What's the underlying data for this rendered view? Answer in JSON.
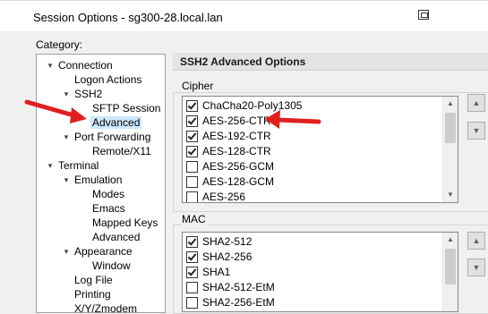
{
  "window": {
    "title": "Session Options - sg300-28.local.lan"
  },
  "category_label": "Category:",
  "tree": [
    {
      "label": "Connection",
      "expander": "▾",
      "name": "tree-item-connection"
    },
    {
      "label": "Logon Actions",
      "expander": "",
      "name": "tree-item-logon-actions"
    },
    {
      "label": "SSH2",
      "expander": "▾",
      "name": "tree-item-ssh2"
    },
    {
      "label": "SFTP Session",
      "expander": "",
      "name": "tree-item-sftp-session"
    },
    {
      "label": "Advanced",
      "expander": "",
      "name": "tree-item-advanced",
      "selected": true
    },
    {
      "label": "Port Forwarding",
      "expander": "▾",
      "name": "tree-item-port-forwarding"
    },
    {
      "label": "Remote/X11",
      "expander": "",
      "name": "tree-item-remote-x11"
    },
    {
      "label": "Terminal",
      "expander": "▾",
      "name": "tree-item-terminal"
    },
    {
      "label": "Emulation",
      "expander": "▾",
      "name": "tree-item-emulation"
    },
    {
      "label": "Modes",
      "expander": "",
      "name": "tree-item-modes"
    },
    {
      "label": "Emacs",
      "expander": "",
      "name": "tree-item-emacs"
    },
    {
      "label": "Mapped Keys",
      "expander": "",
      "name": "tree-item-mapped-keys"
    },
    {
      "label": "Advanced",
      "expander": "",
      "name": "tree-item-emulation-advanced"
    },
    {
      "label": "Appearance",
      "expander": "▾",
      "name": "tree-item-appearance"
    },
    {
      "label": "Window",
      "expander": "",
      "name": "tree-item-window"
    },
    {
      "label": "Log File",
      "expander": "",
      "name": "tree-item-log-file"
    },
    {
      "label": "Printing",
      "expander": "",
      "name": "tree-item-printing"
    },
    {
      "label": "X/Y/Zmodem",
      "expander": "",
      "name": "tree-item-xyzmodem"
    }
  ],
  "panel": {
    "title": "SSH2 Advanced Options"
  },
  "cipher": {
    "label": "Cipher",
    "items": [
      {
        "label": "ChaCha20-Poly1305",
        "checked": true
      },
      {
        "label": "AES-256-CTR",
        "checked": true
      },
      {
        "label": "AES-192-CTR",
        "checked": true
      },
      {
        "label": "AES-128-CTR",
        "checked": true
      },
      {
        "label": "AES-256-GCM",
        "checked": false
      },
      {
        "label": "AES-128-GCM",
        "checked": false
      },
      {
        "label": "AES-256",
        "checked": false
      }
    ]
  },
  "mac": {
    "label": "MAC",
    "items": [
      {
        "label": "SHA2-512",
        "checked": true
      },
      {
        "label": "SHA2-256",
        "checked": true
      },
      {
        "label": "SHA1",
        "checked": true
      },
      {
        "label": "SHA2-512-EtM",
        "checked": false
      },
      {
        "label": "SHA2-256-EtM",
        "checked": false
      }
    ]
  },
  "icons": {
    "up": "up-arrow-icon",
    "down": "down-arrow-icon",
    "annotation": "red-arrow-icon"
  },
  "colors": {
    "annotation_arrow": "#e02020",
    "selection": "#cce8ff"
  }
}
